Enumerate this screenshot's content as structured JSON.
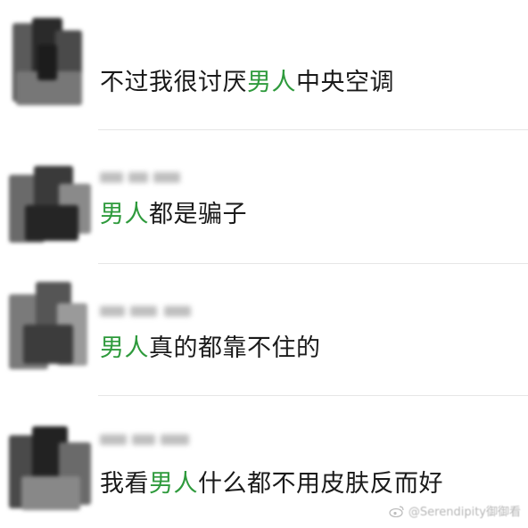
{
  "comments": [
    {
      "pre": "不过我很讨厌",
      "highlight": "男人",
      "post": "中央空调"
    },
    {
      "pre": "",
      "highlight": "男人",
      "post": "都是骗子"
    },
    {
      "pre": "",
      "highlight": "男人",
      "post": "真的都靠不住的"
    },
    {
      "pre": "我看",
      "highlight": "男人",
      "post": "什么都不用皮肤反而好"
    }
  ],
  "colors": {
    "highlight": "#2e9a3c",
    "text": "#1a1a1a",
    "divider": "#e6e6e6"
  },
  "watermark": {
    "icon": "weibo-icon",
    "text": "@Serendipity御御看"
  }
}
